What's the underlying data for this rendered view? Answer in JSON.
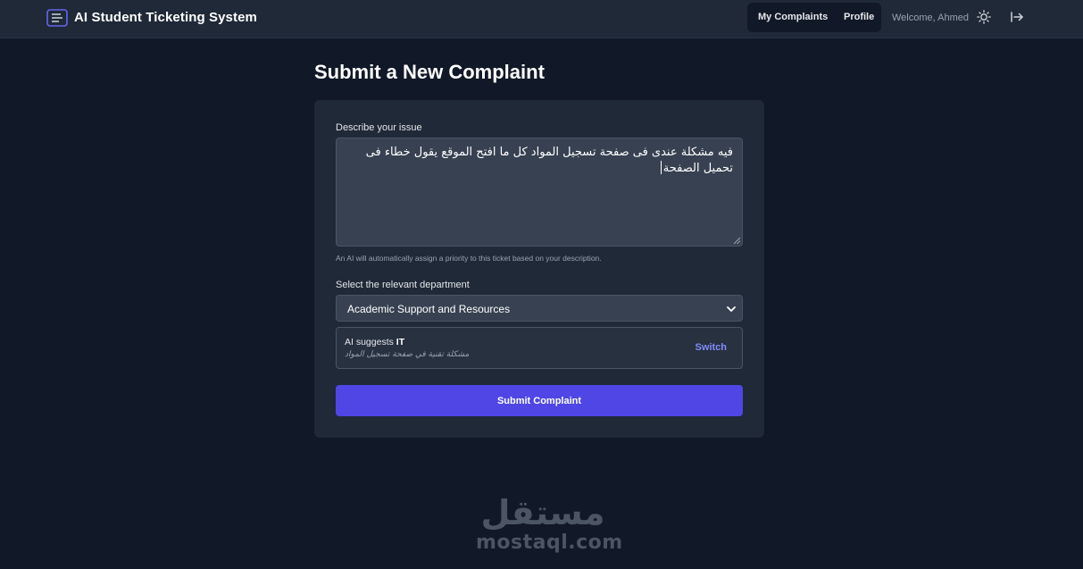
{
  "app": {
    "title": "AI Student Ticketing System",
    "icon": "ticket-list-icon"
  },
  "nav": {
    "links": [
      "My Complaints",
      "Profile"
    ],
    "welcome": "Welcome, Ahmed",
    "theme_icon": "sun-icon",
    "logout_icon": "logout-icon"
  },
  "page": {
    "title": "Submit a New Complaint"
  },
  "form": {
    "description_label": "Describe your issue",
    "description_value": "فيه مشكلة عندى  فى صفحة تسجيل المواد كل ما افتح الموقع يقول خطاء فى تحميل الصفحة",
    "hint": "An AI will automatically assign a priority to this ticket based on your description.",
    "department_label": "Select the relevant department",
    "department_selected": "Academic Support and Resources",
    "suggestion": {
      "prefix": "AI suggests ",
      "department": "IT",
      "reason": "مشكلة تقنية في صفحة تسجيل المواد",
      "switch_label": "Switch"
    },
    "submit_label": "Submit Complaint"
  },
  "watermark": {
    "arabic": "مستقل",
    "latin": "mostaql.com"
  },
  "colors": {
    "background": "#111827",
    "navbar": "#1f2937",
    "card": "#1f2937",
    "input": "#374151",
    "accent": "#4f46e5",
    "link": "#818cf8"
  }
}
